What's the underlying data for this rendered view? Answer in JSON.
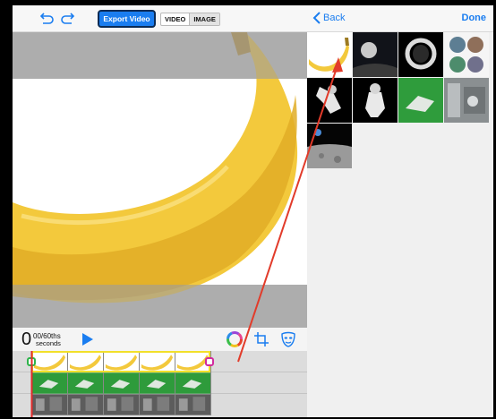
{
  "toolbar": {
    "export_label": "Export Video",
    "mode_video": "VIDEO",
    "mode_image": "IMAGE"
  },
  "playback": {
    "time_whole": "0",
    "time_fraction": "00/60ths",
    "time_unit": "seconds"
  },
  "library": {
    "back_label": "Back",
    "done_label": "Done",
    "items": [
      {
        "name": "banana"
      },
      {
        "name": "moon-planet"
      },
      {
        "name": "astronaut-helmet"
      },
      {
        "name": "space-helmets"
      },
      {
        "name": "astronaut-flying"
      },
      {
        "name": "astronaut-floating"
      },
      {
        "name": "astronaut-green-screen"
      },
      {
        "name": "space-station-interior"
      },
      {
        "name": "earth-from-moon"
      },
      {
        "name": "moon-surface"
      }
    ]
  },
  "colors": {
    "accent": "#1a7df0",
    "annotation_arrow": "#e23b2a",
    "clip_selection": "#f2e02a"
  }
}
